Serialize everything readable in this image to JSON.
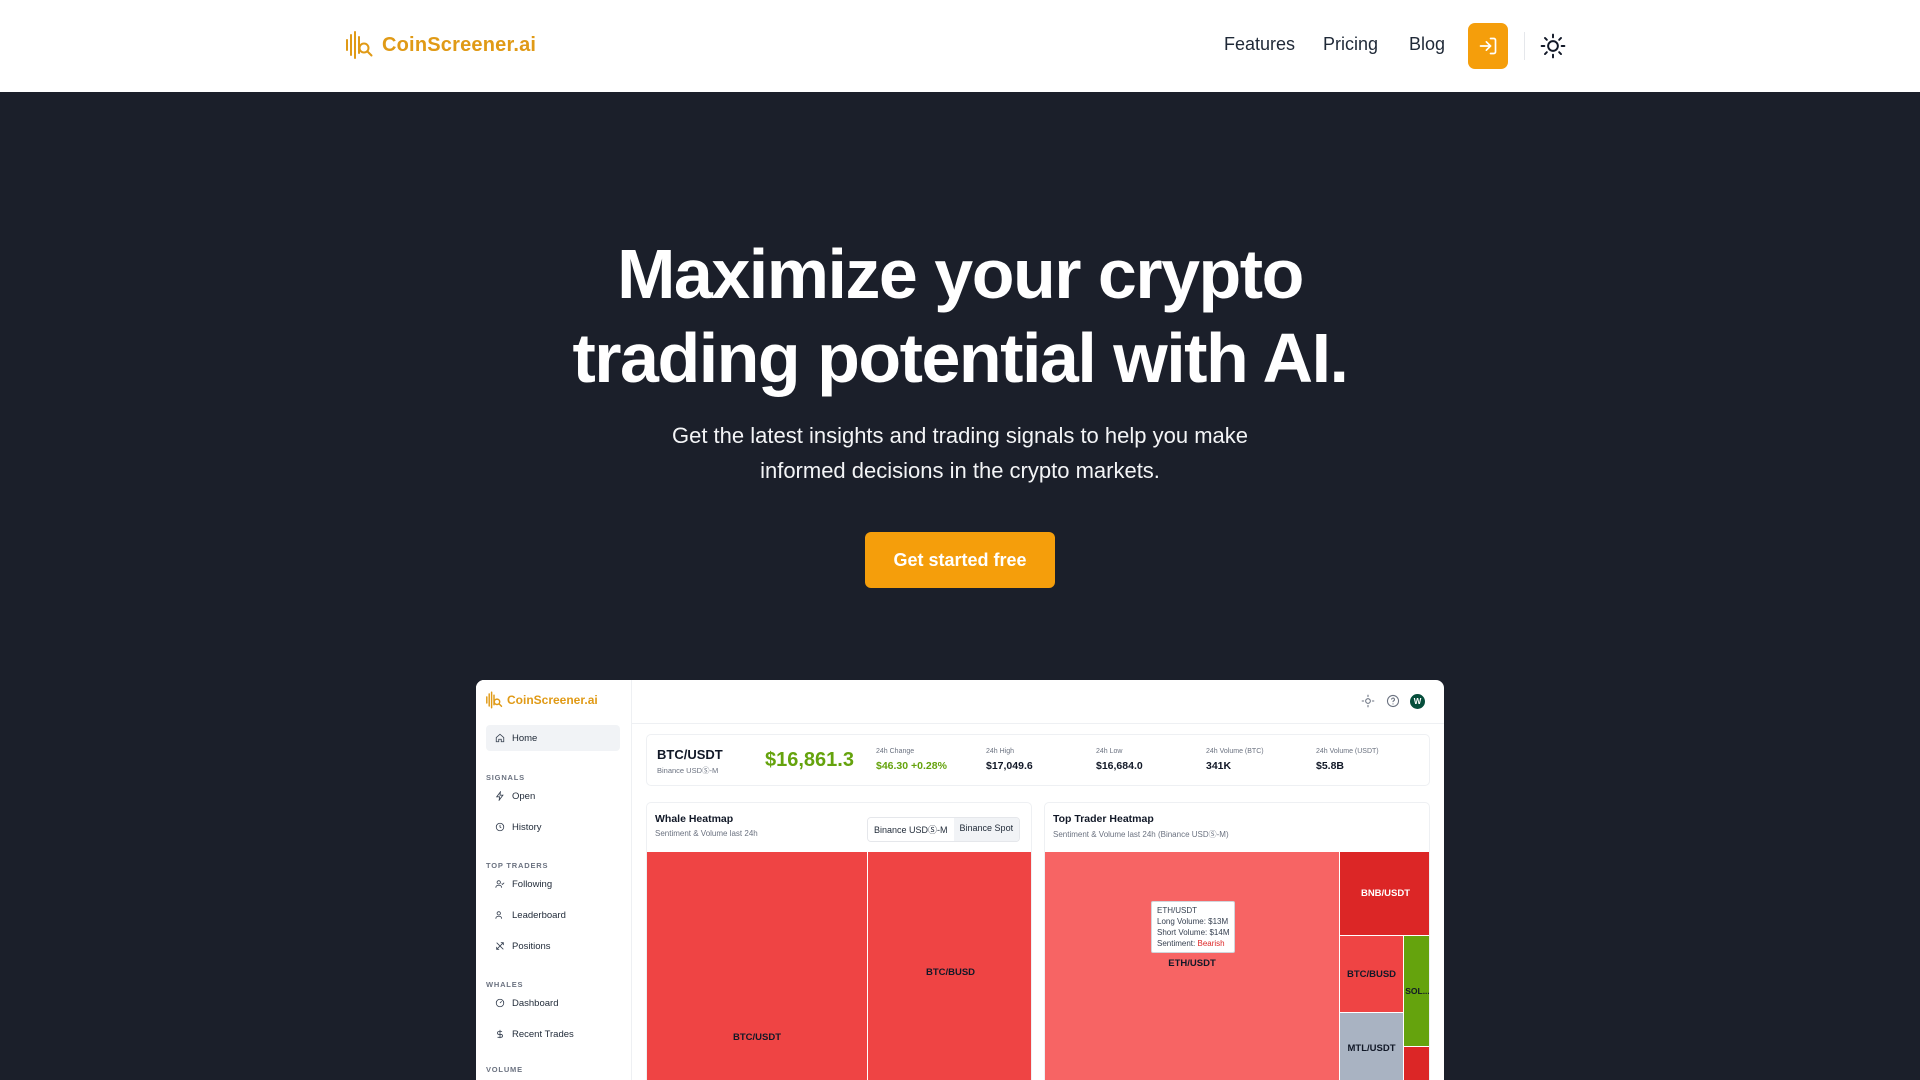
{
  "nav": {
    "brand": "CoinScreener.ai",
    "links": [
      "Features",
      "Pricing",
      "Blog"
    ],
    "icons": {
      "logo": "waveform-search-icon",
      "login": "login-icon",
      "theme": "sun-icon"
    },
    "accent": "#f59e0b"
  },
  "hero": {
    "title_line1": "Maximize your crypto",
    "title_line2": "trading potential with AI.",
    "subtitle_line1": "Get the latest insights and trading signals to help you make",
    "subtitle_line2": "informed decisions in the crypto markets.",
    "cta": "Get started free"
  },
  "app": {
    "brand": "CoinScreener.ai",
    "sidebar": {
      "home": "Home",
      "signals_title": "SIGNALS",
      "signals": [
        "Open",
        "History"
      ],
      "top_traders_title": "TOP TRADERS",
      "top_traders": [
        "Following",
        "Leaderboard",
        "Positions"
      ],
      "whales_title": "WHALES",
      "whales": [
        "Dashboard",
        "Recent Trades"
      ],
      "volume_title": "VOLUME"
    },
    "avatar": "W",
    "ticker": {
      "pair": "BTC/USDT",
      "exchange": "Binance USDⓈ-M",
      "price": "$16,861.3",
      "stats": [
        {
          "label": "24h Change",
          "value": "$46.30 +0.28%",
          "positive": true
        },
        {
          "label": "24h High",
          "value": "$17,049.6"
        },
        {
          "label": "24h Low",
          "value": "$16,684.0"
        },
        {
          "label": "24h Volume (BTC)",
          "value": "341K"
        },
        {
          "label": "24h Volume (USDT)",
          "value": "$5.8B"
        }
      ]
    },
    "whale_heatmap": {
      "title": "Whale Heatmap",
      "subtitle": "Sentiment & Volume last 24h",
      "tabs": [
        "Binance USDⓈ-M",
        "Binance Spot"
      ],
      "cells": [
        "BTC/USDT",
        "BTC/BUSD"
      ]
    },
    "trader_heatmap": {
      "title": "Top Trader Heatmap",
      "subtitle": "Sentiment & Volume last 24h (Binance USDⓈ-M)",
      "cells": [
        "ETH/USDT",
        "BNB/USDT",
        "BTC/BUSD",
        "SOL...",
        "MTL/USDT"
      ],
      "tooltip": {
        "title": "ETH/USDT",
        "long": "Long Volume: $13M",
        "short": "Short Volume: $14M",
        "sentiment_label": "Sentiment:",
        "sentiment": "Bearish"
      }
    },
    "colors": {
      "bearish": "#ef4444",
      "bearish_light": "#f76464",
      "bullish": "#65a30d",
      "neutral": "#a9b3c2",
      "dark_red": "#dc2626"
    }
  }
}
